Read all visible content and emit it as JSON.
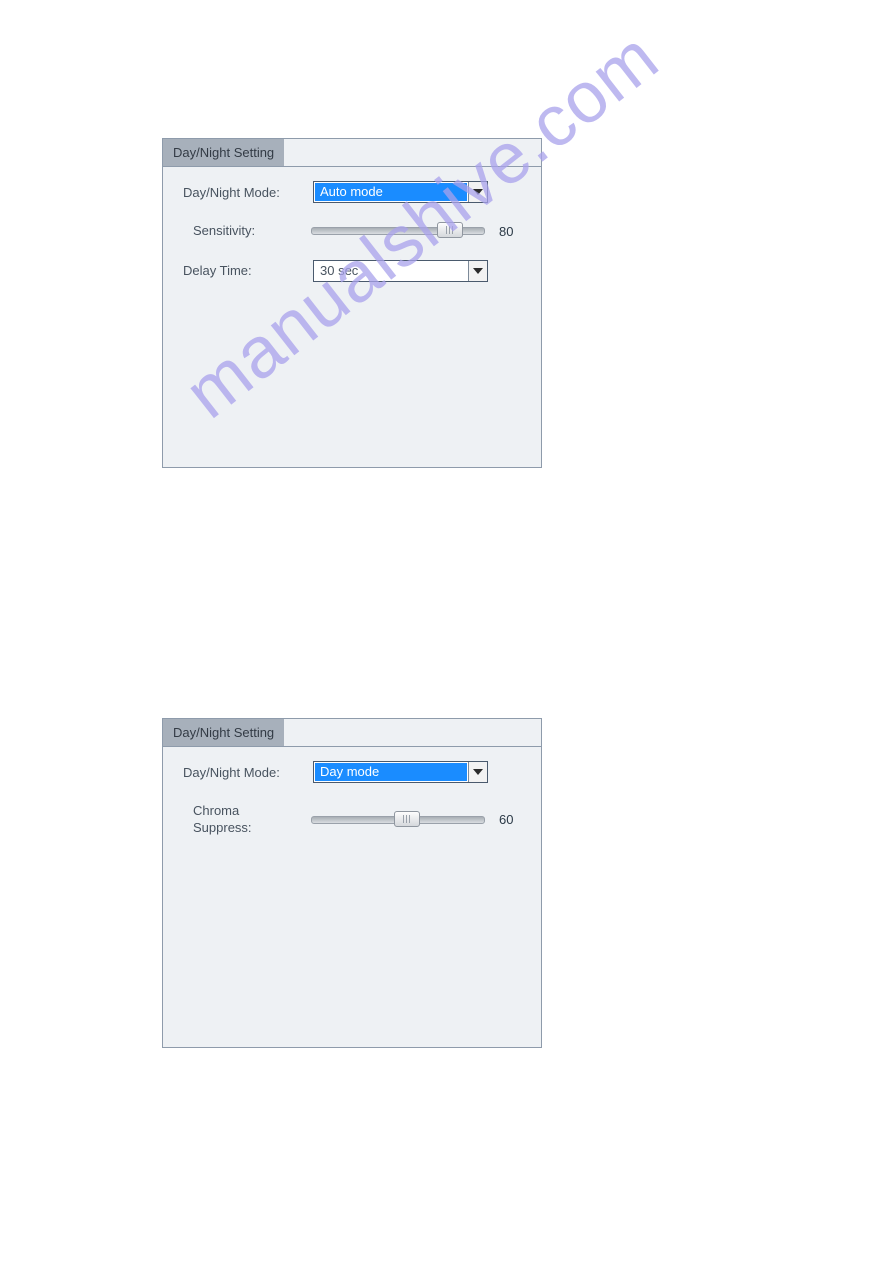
{
  "watermark": "manualshive.com",
  "panel1": {
    "tab": "Day/Night Setting",
    "mode_label": "Day/Night Mode:",
    "mode_value": "Auto mode",
    "sensitivity_label": "Sensitivity:",
    "sensitivity_value": "80",
    "sensitivity_pos_pct": 80,
    "delay_label": "Delay Time:",
    "delay_value": "30 sec"
  },
  "panel2": {
    "tab": "Day/Night Setting",
    "mode_label": "Day/Night Mode:",
    "mode_value": "Day mode",
    "chroma_label": "Chroma Suppress:",
    "chroma_value": "60",
    "chroma_pos_pct": 55
  }
}
